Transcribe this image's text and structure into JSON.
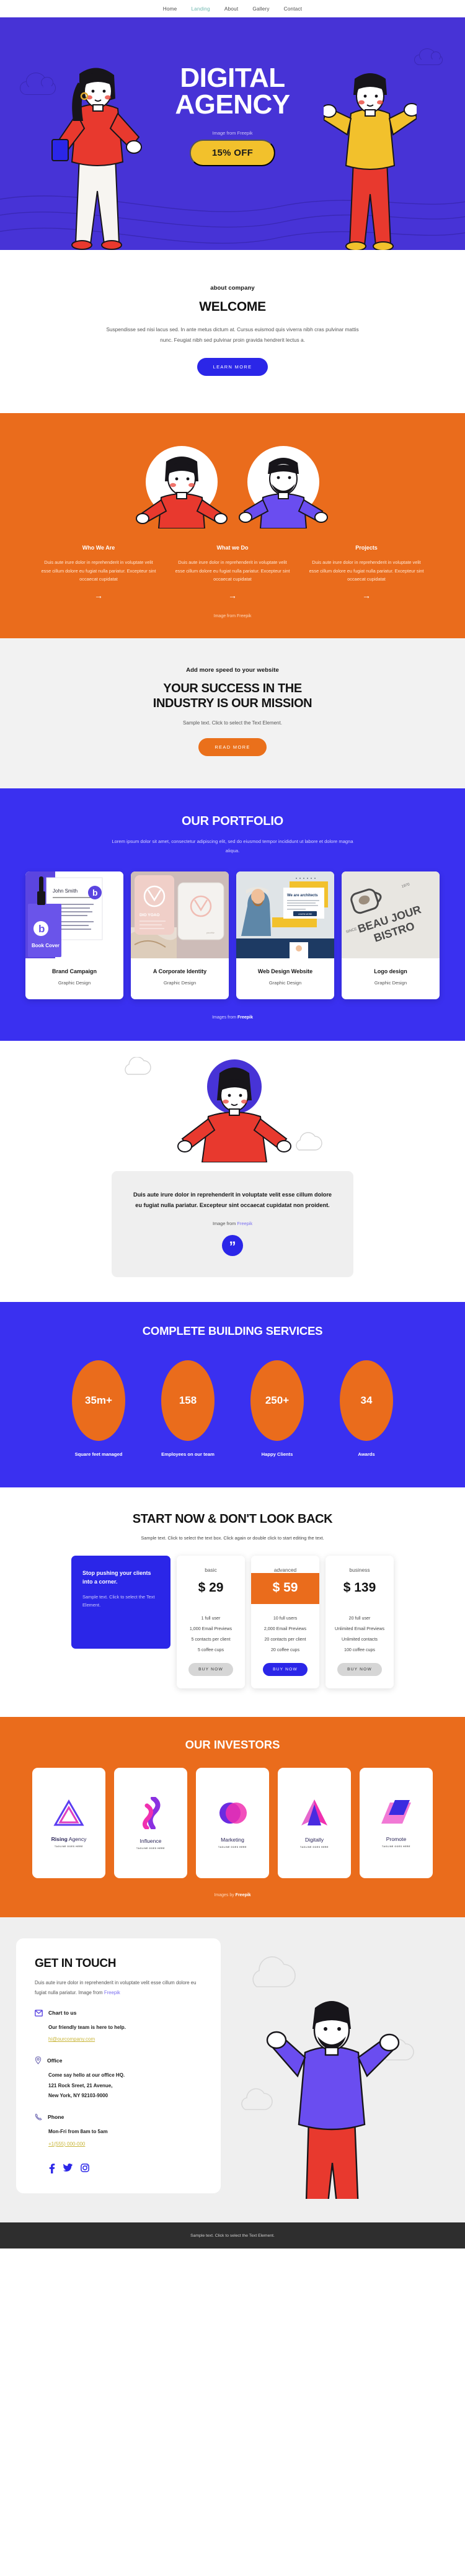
{
  "nav": {
    "items": [
      {
        "label": "Home",
        "active": false
      },
      {
        "label": "Landing",
        "active": true
      },
      {
        "label": "About",
        "active": false
      },
      {
        "label": "Gallery",
        "active": false
      },
      {
        "label": "Contact",
        "active": false
      }
    ]
  },
  "hero": {
    "title_line1": "DIGITAL",
    "title_line2": "AGENCY",
    "credit": "Image from Freepik",
    "badge": "15% OFF",
    "bg_color": "#4733d6"
  },
  "welcome": {
    "eyebrow": "about company",
    "heading": "WELCOME",
    "body": "Suspendisse sed nisi lacus sed. In ante metus dictum at. Cursus euismod quis viverra nibh cras pulvinar mattis nunc. Feugiat nibh sed pulvinar proin gravida hendrerit lectus a.",
    "cta": "LEARN MORE"
  },
  "features": {
    "bg_color": "#ea6c1c",
    "credit": "Image from Freepik",
    "columns": [
      {
        "title": "Who We Are",
        "body": "Duis aute irure dolor in reprehenderit in voluptate velit esse cillum dolore eu fugiat nulla pariatur. Excepteur sint occaecat cupidatat",
        "arrow": "→"
      },
      {
        "title": "What we Do",
        "body": "Duis aute irure dolor in reprehenderit in voluptate velit esse cillum dolore eu fugiat nulla pariatur. Excepteur sint occaecat cupidatat",
        "arrow": "→"
      },
      {
        "title": "Projects",
        "body": "Duis aute irure dolor in reprehenderit in voluptate velit esse cillum dolore eu fugiat nulla pariatur. Excepteur sint occaecat cupidatat",
        "arrow": "→"
      }
    ]
  },
  "mission": {
    "eyebrow": "Add more speed to your website",
    "heading_line1": "YOUR SUCCESS IN THE",
    "heading_line2": "INDUSTRY IS OUR MISSION",
    "sub": "Sample text. Click to select the Text Element.",
    "cta": "READ MORE"
  },
  "portfolio": {
    "heading": "OUR PORTFOLIO",
    "sub": "Lorem ipsum dolor sit amet, consectetur adipiscing elit, sed do eiusmod tempor incididunt ut labore et dolore magna aliqua.",
    "credit_prefix": "Images from ",
    "credit_brand": "Freepik",
    "cards": [
      {
        "title": "Brand Campaign",
        "meta": "Graphic Design",
        "thumb_label": "Book Cover",
        "thumb_name": "John Smith"
      },
      {
        "title": "A Corporate Identity",
        "meta": "Graphic Design",
        "thumb_label": "DIO YOAO",
        "thumb_name": ""
      },
      {
        "title": "Web Design Website",
        "meta": "Graphic Design",
        "thumb_label": "We are architects",
        "thumb_name": "LEARN MORE"
      },
      {
        "title": "Logo design",
        "meta": "Graphic Design",
        "thumb_label": "BEAU JOUR BISTRO",
        "thumb_name": "SINCE 1970"
      }
    ]
  },
  "testimonial": {
    "quote": "Duis aute irure dolor in reprehenderit in voluptate velit esse cillum dolore eu fugiat nulla pariatur. Excepteur sint occaecat cupidatat non proident.",
    "credit_prefix": "Image from ",
    "credit_brand": "Freepik",
    "mark": "”"
  },
  "stats": {
    "heading": "COMPLETE BUILDING SERVICES",
    "items": [
      {
        "value": "35m+",
        "label": "Square feet managed"
      },
      {
        "value": "158",
        "label": "Employees on our team"
      },
      {
        "value": "250+",
        "label": "Happy Clients"
      },
      {
        "value": "34",
        "label": "Awards"
      }
    ]
  },
  "pricing": {
    "heading": "START NOW & DON'T LOOK BACK",
    "sub": "Sample text. Click to select the text box. Click again or double click to start editing the text.",
    "promo": {
      "title": "Stop pushing your clients into a corner.",
      "body": "Sample text. Click to select the Text Element."
    },
    "tiers": [
      {
        "name": "basic",
        "price": "$ 29",
        "highlight": false,
        "features": [
          "1 full user",
          "1,000 Email Previews",
          "5 contacts per client",
          "5 coffee cups"
        ],
        "cta": "BUY NOW"
      },
      {
        "name": "advanced",
        "price": "$ 59",
        "highlight": true,
        "features": [
          "10 full users",
          "2,000 Email Previews",
          "20 contacts per client",
          "20 coffee cups"
        ],
        "cta": "BUY NOW"
      },
      {
        "name": "business",
        "price": "$ 139",
        "highlight": false,
        "features": [
          "20 full user",
          "Unlimited Email Previews",
          "Unlimited contacts",
          "100 coffee cups"
        ],
        "cta": "BUY NOW"
      }
    ]
  },
  "investors": {
    "heading": "OUR INVESTORS",
    "credit_prefix": "Images by ",
    "credit_brand": "Freepik",
    "logos": [
      {
        "name_bold": "Rising",
        "name_rest": " Agency",
        "tagline": "TAGLINE GOES HERE"
      },
      {
        "name_bold": "",
        "name_rest": "Influence",
        "tagline": "TAGLINE GOES HERE"
      },
      {
        "name_bold": "",
        "name_rest": "Marketing",
        "tagline": "TAGLINE GOES HERE"
      },
      {
        "name_bold": "",
        "name_rest": "Digitally",
        "tagline": "TAGLINE GOES HERE"
      },
      {
        "name_bold": "",
        "name_rest": "Promote",
        "tagline": "TAGLINE GOES HERE"
      }
    ]
  },
  "contact": {
    "heading": "GET IN TOUCH",
    "desc_text": "Duis aute irure dolor in reprehenderit in voluptate velit esse cillum dolore eu fugiat nulla pariatur. Image from ",
    "desc_brand": "Freepik",
    "blocks": [
      {
        "icon": "mail-icon",
        "title": "Chart to us",
        "lines": [
          "Our friendly team is here to help."
        ],
        "link": "hi@ourcompany.com"
      },
      {
        "icon": "location-pin-icon",
        "title": "Office",
        "lines": [
          "Come say hello at our office HQ.",
          "121 Rock Sreet, 21 Avenue,",
          "New York, NY 92103-9000"
        ],
        "link": ""
      },
      {
        "icon": "phone-icon",
        "title": "Phone",
        "lines": [
          "Mon-Fri from 8am to 5am"
        ],
        "link": "+1(555) 000-000"
      }
    ],
    "socials": [
      "facebook-icon",
      "twitter-icon",
      "instagram-icon"
    ]
  },
  "footer": {
    "text": "Sample text. Click to select the Text Element."
  },
  "colors": {
    "blue": "#3a30f0",
    "deep_blue": "#2b26e8",
    "hero_blue": "#4733d6",
    "orange": "#ea6c1c",
    "yellow": "#f2c12c",
    "grey": "#efefef"
  }
}
